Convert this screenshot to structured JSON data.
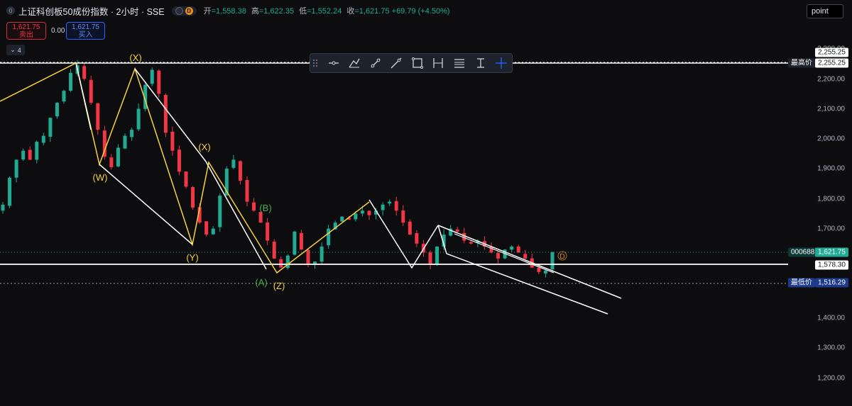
{
  "header": {
    "symbol_badge": "0",
    "title": "上证科创板50成份指数 · 2小时 · SSE",
    "status_letter": "D",
    "ohlc": [
      {
        "key": "开",
        "value": "=1,558.38"
      },
      {
        "key": "高",
        "value": "=1,622.35"
      },
      {
        "key": "低",
        "value": "=1,552.24"
      },
      {
        "key": "收",
        "value": "=1,621.75 +69.79 (+4.50%)"
      }
    ],
    "point_button": "point"
  },
  "trade": {
    "sell_price": "1,621.75",
    "sell_label": "卖出",
    "spread": "0.00",
    "buy_price": "1,621.75",
    "buy_label": "买入"
  },
  "indicators_collapse": {
    "count": "4"
  },
  "drawing_toolbar": {
    "tools": [
      "horizontal-line-icon",
      "path-curve-icon",
      "trend-line-icon",
      "ray-line-icon",
      "rectangle-icon",
      "date-range-icon",
      "price-range-icon",
      "fixed-range-icon",
      "crosshair-icon"
    ]
  },
  "price_axis": {
    "ticks": [
      "2,300.00",
      "2,200.00",
      "2,100.00",
      "2,000.00",
      "1,900.00",
      "1,800.00",
      "1,700.00",
      "1,400.00",
      "1,300.00",
      "1,200.00"
    ],
    "tags": {
      "top_line": "2,255.25",
      "highest_label": "最高价",
      "highest_value": "2,255.25",
      "current_symbol": "000688",
      "current_value": "1,621.75",
      "support_value": "1,578.30",
      "lowest_label": "最低价",
      "lowest_value": "1,516.29"
    }
  },
  "wave_labels": [
    {
      "text": "(X)",
      "color": "#f7d23d"
    },
    {
      "text": "(W)",
      "color": "#f7d23d"
    },
    {
      "text": "(X)",
      "color": "#f7d23d"
    },
    {
      "text": "(Y)",
      "color": "#f7d23d"
    },
    {
      "text": "(B)",
      "color": "#4caf50"
    },
    {
      "text": "(A)",
      "color": "#4caf50"
    },
    {
      "text": "(Z)",
      "color": "#f7d23d"
    }
  ],
  "chart_marker": {
    "letter": "D",
    "color": "#e8901a"
  },
  "chart_data": {
    "type": "candlestick",
    "interval": "2小时",
    "ylim": [
      1150,
      2320
    ],
    "grid": false,
    "up_color": "#22ab94",
    "down_color": "#f23645",
    "last_close": 1621.75,
    "highest": 2255.25,
    "lowest": 1516.29,
    "support_level": 1578.3,
    "closes": [
      1780,
      1870,
      1930,
      1960,
      1930,
      1990,
      2010,
      2070,
      2120,
      2160,
      2220,
      2245,
      2200,
      2120,
      2030,
      1940,
      1905,
      1970,
      2010,
      2030,
      2100,
      2180,
      2230,
      2150,
      2020,
      1960,
      1890,
      1840,
      1770,
      1720,
      1680,
      1700,
      1810,
      1900,
      1930,
      1860,
      1790,
      1760,
      1720,
      1660,
      1600,
      1570,
      1610,
      1690,
      1630,
      1580,
      1590,
      1640,
      1700,
      1720,
      1740,
      1730,
      1750,
      1760,
      1745,
      1760,
      1780,
      1790,
      1760,
      1720,
      1680,
      1650,
      1620,
      1580,
      1640,
      1680,
      1700,
      1690,
      1660,
      1650,
      1660,
      1640,
      1620,
      1600,
      1630,
      1640,
      1620,
      1600,
      1570,
      1555,
      1560,
      1621.75
    ]
  }
}
